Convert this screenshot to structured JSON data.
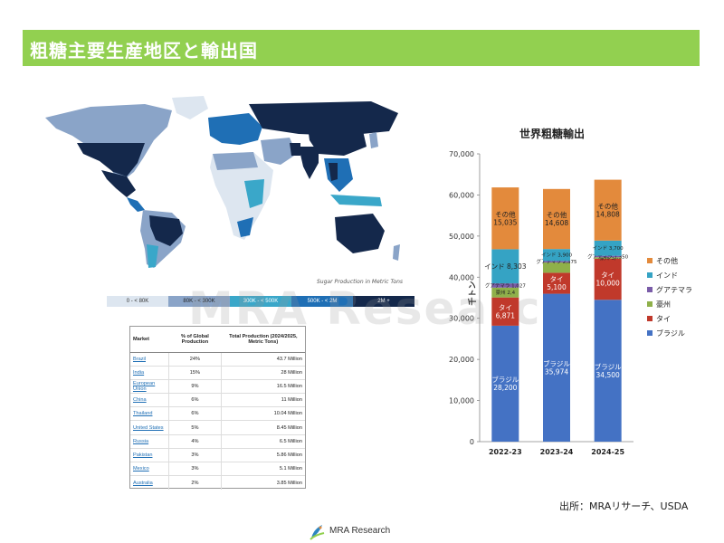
{
  "slide": {
    "title": "粗糖主要生産地区と輸出国",
    "source": "出所：MRAリサーチ、USDA",
    "logo_text": "MRA Research",
    "watermark": "MRA Research",
    "title_bar_color": "#92d050"
  },
  "map": {
    "caption": "Sugar Production in Metric Tons",
    "legend": [
      {
        "label": "0 - < 80K",
        "color": "#dde6f0"
      },
      {
        "label": "80K - < 300K",
        "color": "#8aa4c8"
      },
      {
        "label": "300K - < 500K",
        "color": "#3aa7c9"
      },
      {
        "label": "500K - < 2M",
        "color": "#1f6fb5"
      },
      {
        "label": "2M +",
        "color": "#14284b"
      }
    ]
  },
  "table": {
    "headers": [
      "Market",
      "% of Global Production",
      "Total Production (2024/2025, Metric Tons)"
    ],
    "rows": [
      [
        "Brazil",
        "24%",
        "43.7 Million"
      ],
      [
        "India",
        "15%",
        "28 Million"
      ],
      [
        "European Union",
        "9%",
        "16.5 Million"
      ],
      [
        "China",
        "6%",
        "11 Million"
      ],
      [
        "Thailand",
        "6%",
        "10.04 Million"
      ],
      [
        "United States",
        "5%",
        "8.45 Million"
      ],
      [
        "Russia",
        "4%",
        "6.5 Million"
      ],
      [
        "Pakistan",
        "3%",
        "5.86 Million"
      ],
      [
        "Mexico",
        "3%",
        "5.1 Million"
      ],
      [
        "Australia",
        "2%",
        "3.85 Million"
      ]
    ]
  },
  "chart_data": {
    "type": "bar",
    "stacked": true,
    "title": "世界粗糖輸出",
    "ylabel": "千トン",
    "ylim": [
      0,
      70000
    ],
    "yticks": [
      0,
      10000,
      20000,
      30000,
      40000,
      50000,
      60000,
      70000
    ],
    "ytick_labels": [
      "0",
      "10,000",
      "20,000",
      "30,000",
      "40,000",
      "50,000",
      "60,000",
      "70,000"
    ],
    "categories": [
      "2022-23",
      "2023-24",
      "2024-25"
    ],
    "grid": false,
    "legend_position": "right",
    "series": [
      {
        "name": "ブラジル",
        "color": "#4472c4",
        "values": [
          28200,
          35974,
          34500
        ],
        "labels": [
          "ブラジル\n28,200",
          "ブラジル\n35,974",
          "ブラジル\n34,500"
        ]
      },
      {
        "name": "タイ",
        "color": "#c0392b",
        "values": [
          6871,
          5100,
          10000
        ],
        "labels": [
          "タイ\n6,871",
          "タイ\n5,100",
          "タイ\n10,000"
        ]
      },
      {
        "name": "豪州",
        "color": "#8fb04a",
        "values": [
          2400,
          2500,
          350
        ],
        "labels": [
          "豪州 2,4",
          "",
          "豪州 3,"
        ]
      },
      {
        "name": "グアテマラ",
        "color": "#7a5ca8",
        "values": [
          1027,
          375,
          350
        ],
        "labels": [
          "グアテマラ 1,027",
          "グアテマラ 2,375",
          "グアテマラ 1,350"
        ]
      },
      {
        "name": "インド",
        "color": "#35a3c4",
        "values": [
          8303,
          2900,
          3700
        ],
        "labels": [
          "インド 8,303",
          "インド 3,900",
          "インド 3,700"
        ]
      },
      {
        "name": "その他",
        "color": "#e38a3c",
        "values": [
          15035,
          14608,
          14808
        ],
        "labels": [
          "その他\n15,035",
          "その他\n14,608",
          "その他\n14,808"
        ]
      }
    ]
  }
}
